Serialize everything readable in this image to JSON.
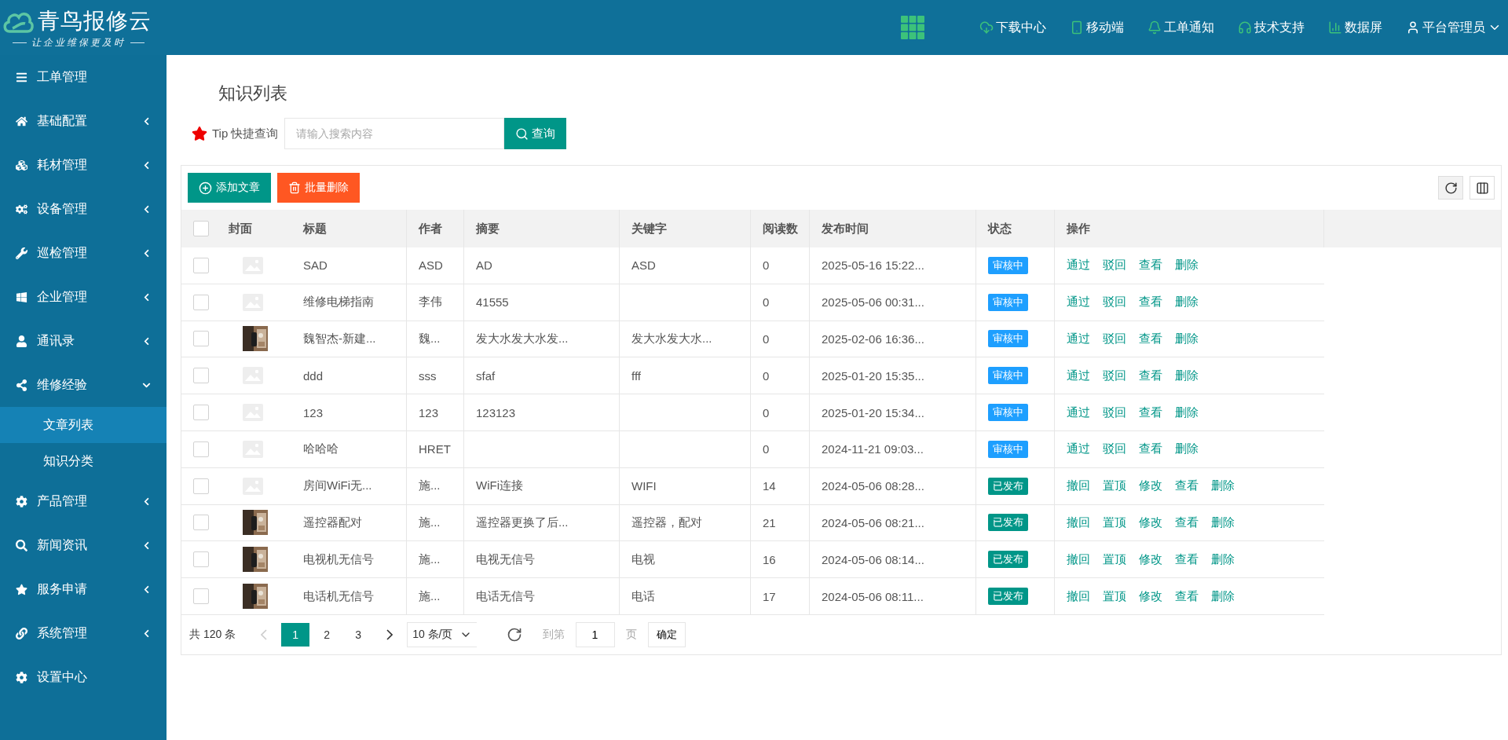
{
  "brand": {
    "name": "青鸟报修云",
    "slogan": "让企业维保更及时"
  },
  "top_nav": {
    "items": [
      "下载中心",
      "移动端",
      "工单通知",
      "技术支持",
      "数据屏"
    ],
    "user": "平台管理员"
  },
  "sidebar": {
    "items": [
      {
        "label": "工单管理",
        "kind": "link"
      },
      {
        "label": "基础配置",
        "kind": "group",
        "expanded": false
      },
      {
        "label": "耗材管理",
        "kind": "group",
        "expanded": false
      },
      {
        "label": "设备管理",
        "kind": "group",
        "expanded": false
      },
      {
        "label": "巡检管理",
        "kind": "group",
        "expanded": false
      },
      {
        "label": "企业管理",
        "kind": "group",
        "expanded": false
      },
      {
        "label": "通讯录",
        "kind": "group",
        "expanded": false
      },
      {
        "label": "维修经验",
        "kind": "group",
        "expanded": true,
        "children": [
          {
            "label": "文章列表",
            "selected": true
          },
          {
            "label": "知识分类",
            "selected": false
          }
        ]
      },
      {
        "label": "产品管理",
        "kind": "group",
        "expanded": false
      },
      {
        "label": "新闻资讯",
        "kind": "group",
        "expanded": false
      },
      {
        "label": "服务申请",
        "kind": "group",
        "expanded": false
      },
      {
        "label": "系统管理",
        "kind": "group",
        "expanded": false
      },
      {
        "label": "设置中心",
        "kind": "link"
      }
    ]
  },
  "page_title": "知识列表",
  "search": {
    "label": "Tip 快捷查询",
    "placeholder": "请输入搜索内容",
    "button": "查询"
  },
  "toolbar": {
    "add_button": "添加文章",
    "batch_delete_button": "批量删除"
  },
  "table": {
    "select_all_checked": false,
    "columns": [
      "封面",
      "标题",
      "作者",
      "摘要",
      "关键字",
      "阅读数",
      "发布时间",
      "状态",
      "操作"
    ],
    "rows": [
      {
        "checked": false,
        "cover": {
          "kind": "placeholder"
        },
        "title": "SAD",
        "author": "ASD",
        "summary": "AD",
        "keywords": "ASD",
        "reads": "0",
        "time": "2025-05-16 15:22...",
        "status": {
          "label": "审核中",
          "color": "#1e9fff"
        },
        "actions": [
          "通过",
          "驳回",
          "查看",
          "删除"
        ]
      },
      {
        "checked": false,
        "cover": {
          "kind": "placeholder"
        },
        "title": "维修电梯指南",
        "author": "李伟",
        "summary": "41555",
        "reads": "0",
        "time": "2025-05-06 00:31...",
        "status": {
          "label": "审核中",
          "color": "#1e9fff"
        },
        "actions": [
          "通过",
          "驳回",
          "查看",
          "删除"
        ]
      },
      {
        "checked": false,
        "cover": {
          "kind": "picture"
        },
        "title": "魏智杰-新建...",
        "author": "魏...",
        "summary": "发大水发大水发...",
        "keywords": "发大水发大水...",
        "reads": "0",
        "time": "2025-02-06 16:36...",
        "status": {
          "label": "审核中",
          "color": "#1e9fff"
        },
        "actions": [
          "通过",
          "驳回",
          "查看",
          "删除"
        ]
      },
      {
        "checked": false,
        "cover": {
          "kind": "placeholder"
        },
        "title": "ddd",
        "author": "sss",
        "summary": "sfaf",
        "keywords": "fff",
        "reads": "0",
        "time": "2025-01-20 15:35...",
        "status": {
          "label": "审核中",
          "color": "#1e9fff"
        },
        "actions": [
          "通过",
          "驳回",
          "查看",
          "删除"
        ]
      },
      {
        "checked": false,
        "cover": {
          "kind": "placeholder"
        },
        "title": "123",
        "author": "123",
        "summary": "123123",
        "reads": "0",
        "time": "2025-01-20 15:34...",
        "status": {
          "label": "审核中",
          "color": "#1e9fff"
        },
        "actions": [
          "通过",
          "驳回",
          "查看",
          "删除"
        ]
      },
      {
        "checked": false,
        "cover": {
          "kind": "placeholder"
        },
        "title": "哈哈哈",
        "author": "HRET",
        "reads": "0",
        "time": "2024-11-21 09:03...",
        "status": {
          "label": "审核中",
          "color": "#1e9fff"
        },
        "actions": [
          "通过",
          "驳回",
          "查看",
          "删除"
        ]
      },
      {
        "checked": false,
        "cover": {
          "kind": "placeholder"
        },
        "title": "房间WiFi无...",
        "author": "施...",
        "summary": "WiFi连接",
        "keywords": "WIFI",
        "reads": "14",
        "time": "2024-05-06 08:28...",
        "status": {
          "label": "已发布",
          "color": "#009688"
        },
        "actions": [
          "撤回",
          "置顶",
          "修改",
          "查看",
          "删除"
        ]
      },
      {
        "checked": false,
        "cover": {
          "kind": "picture"
        },
        "title": "遥控器配对",
        "author": "施...",
        "summary": "遥控器更换了后...",
        "keywords": "遥控器，配对",
        "reads": "21",
        "time": "2024-05-06 08:21...",
        "status": {
          "label": "已发布",
          "color": "#009688"
        },
        "actions": [
          "撤回",
          "置顶",
          "修改",
          "查看",
          "删除"
        ]
      },
      {
        "checked": false,
        "cover": {
          "kind": "picture"
        },
        "title": "电视机无信号",
        "author": "施...",
        "summary": "电视无信号",
        "keywords": "电视",
        "reads": "16",
        "time": "2024-05-06 08:14...",
        "status": {
          "label": "已发布",
          "color": "#009688"
        },
        "actions": [
          "撤回",
          "置顶",
          "修改",
          "查看",
          "删除"
        ]
      },
      {
        "checked": false,
        "cover": {
          "kind": "picture"
        },
        "title": "电话机无信号",
        "author": "施...",
        "summary": "电话无信号",
        "keywords": "电话",
        "reads": "17",
        "time": "2024-05-06 08:11...",
        "status": {
          "label": "已发布",
          "color": "#009688"
        },
        "actions": [
          "撤回",
          "置顶",
          "修改",
          "查看",
          "删除"
        ]
      }
    ]
  },
  "pagination": {
    "total": "共 120 条",
    "pages": [
      {
        "label": "1",
        "selected": true
      },
      {
        "label": "2",
        "selected": false
      },
      {
        "label": "3",
        "selected": false
      }
    ],
    "page_size": "10 条/页",
    "goto_label": "到第",
    "goto_value": "1",
    "page_unit": "页",
    "confirm": "确定"
  }
}
